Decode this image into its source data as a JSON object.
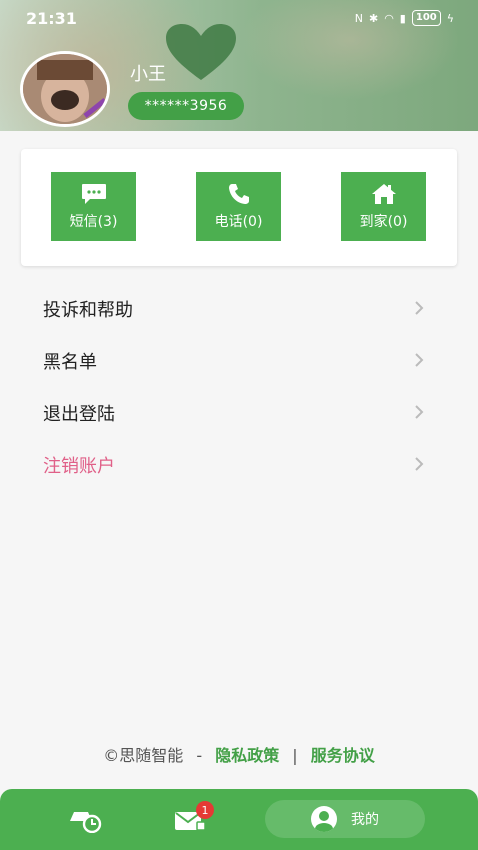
{
  "status_bar": {
    "time": "21:31",
    "battery": "100"
  },
  "profile": {
    "name": "小王",
    "phone_masked": "******3956"
  },
  "stats": [
    {
      "label": "短信(3)",
      "icon": "message-icon"
    },
    {
      "label": "电话(0)",
      "icon": "phone-icon"
    },
    {
      "label": "到家(0)",
      "icon": "home-icon"
    }
  ],
  "menu": [
    {
      "label": "投诉和帮助"
    },
    {
      "label": "黑名单"
    },
    {
      "label": "退出登陆"
    },
    {
      "label": "注销账户"
    }
  ],
  "footer": {
    "copyright": "©思随智能",
    "dash": "-",
    "privacy": "隐私政策",
    "separator": "|",
    "terms": "服务协议"
  },
  "bottom_nav": {
    "badge_count": "1",
    "mine_label": "我的"
  },
  "colors": {
    "primary": "#4caf50",
    "danger": "#e06088"
  }
}
